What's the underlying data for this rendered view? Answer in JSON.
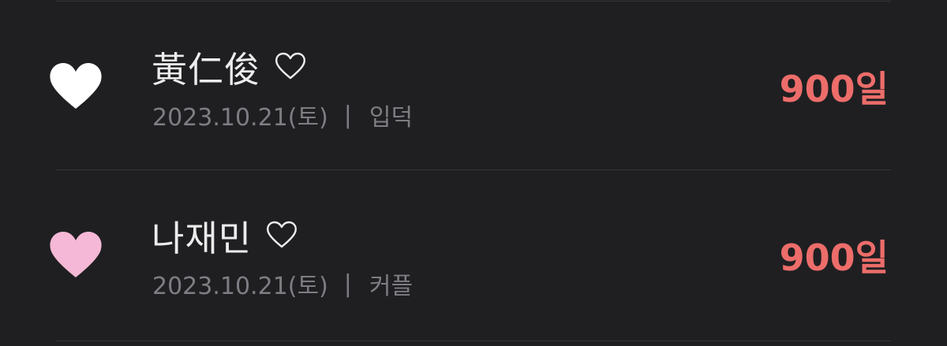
{
  "colors": {
    "background": "#1f1f22",
    "divider": "#36363b",
    "name_text": "#ececec",
    "sub_text": "#7d7d83",
    "days_accent": "#ec6d6a"
  },
  "items": [
    {
      "icon": "white-heart-icon",
      "icon_color": "#ffffff",
      "name": "黃仁俊",
      "name_icon": "outline-heart-icon",
      "date": "2023.10.21(토)",
      "separator": "|",
      "tag": "입덕",
      "days": "900일"
    },
    {
      "icon": "pink-heart-icon",
      "icon_color": "#f5b8d6",
      "name": "나재민",
      "name_icon": "outline-heart-icon",
      "date": "2023.10.21(토)",
      "separator": "|",
      "tag": "커플",
      "days": "900일"
    }
  ]
}
